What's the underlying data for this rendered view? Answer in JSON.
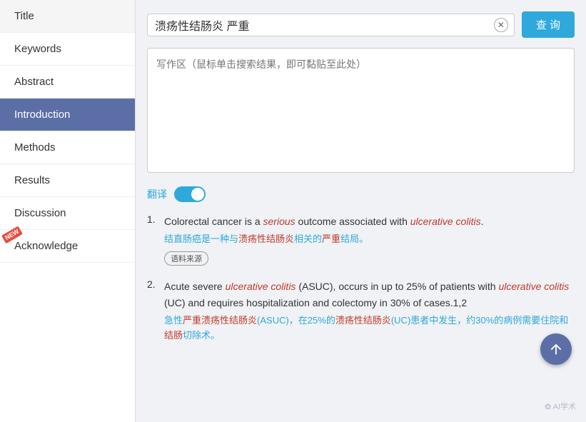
{
  "sidebar": {
    "items": [
      {
        "id": "title",
        "label": "Title",
        "active": false,
        "new": false
      },
      {
        "id": "keywords",
        "label": "Keywords",
        "active": false,
        "new": false
      },
      {
        "id": "abstract",
        "label": "Abstract",
        "active": false,
        "new": false
      },
      {
        "id": "introduction",
        "label": "Introduction",
        "active": true,
        "new": false
      },
      {
        "id": "methods",
        "label": "Methods",
        "active": false,
        "new": false
      },
      {
        "id": "results",
        "label": "Results",
        "active": false,
        "new": false
      },
      {
        "id": "discussion",
        "label": "Discussion",
        "active": false,
        "new": false
      },
      {
        "id": "acknowledge",
        "label": "Acknowledge",
        "active": false,
        "new": true
      }
    ]
  },
  "search": {
    "query": "溃疡性结肠炎 严重",
    "placeholder": "写作区（鼠标单击搜索结果，即可黏贴至此处）",
    "query_btn_label": "查 询"
  },
  "translate": {
    "label": "翻译"
  },
  "results": [
    {
      "number": "1.",
      "en_parts": [
        {
          "text": "Colorectal cancer is a ",
          "style": "normal"
        },
        {
          "text": "serious",
          "style": "italic-red"
        },
        {
          "text": " outcome associated with ",
          "style": "normal"
        },
        {
          "text": "ulcerative colitis",
          "style": "italic-red"
        },
        {
          "text": ".",
          "style": "normal"
        }
      ],
      "zh": "结直肠癌是一种与溃疡性结肠炎相关的严重结局。",
      "zh_red_words": [
        "溃疡性结肠炎",
        "严重"
      ],
      "source_tag": "语料来源"
    },
    {
      "number": "2.",
      "en_parts": [
        {
          "text": "Acute severe ",
          "style": "normal"
        },
        {
          "text": "ulcerative colitis",
          "style": "italic-red"
        },
        {
          "text": " (ASUC), occurs in up to 25% of patients with ",
          "style": "normal"
        },
        {
          "text": "ulcerative colitis",
          "style": "italic-red"
        },
        {
          "text": " (UC) and requires hospitalization and colectomy in 30% of cases.1,2",
          "style": "normal"
        }
      ],
      "zh": "急性严重溃疡性结肠炎(ASUC)，在25%的溃疡性结肠炎(UC)患者中发生，约30%的病例需要住院和结肠切除术。",
      "zh_red_words": [
        "严重溃疡性结肠炎",
        "溃疡性结肠炎",
        "结肠"
      ],
      "source_tag": ""
    }
  ],
  "watermark": "✿ AI学术"
}
